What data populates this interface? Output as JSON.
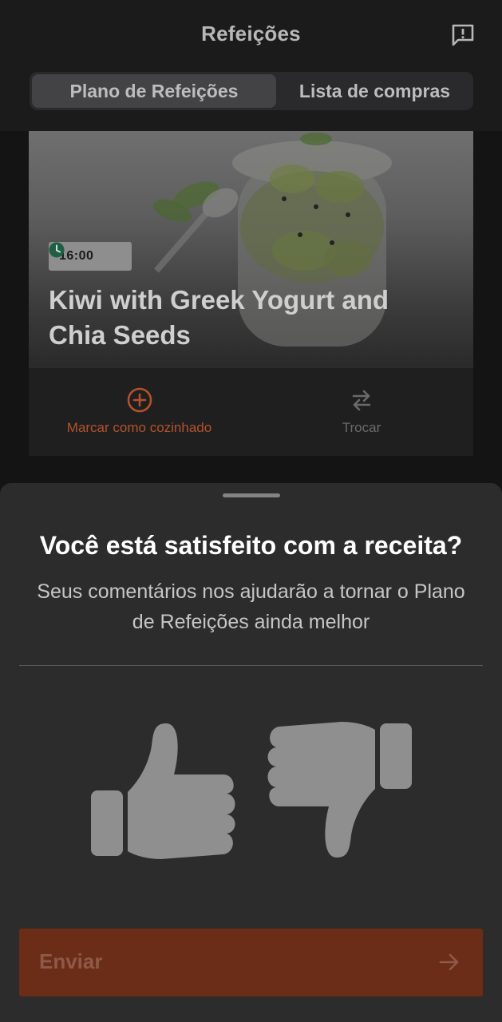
{
  "header": {
    "title": "Refeições",
    "tabs": [
      {
        "label": "Plano de Refeições",
        "active": true
      },
      {
        "label": "Lista de compras",
        "active": false
      }
    ],
    "feedback_icon": "feedback-flag-icon"
  },
  "recipe_card": {
    "time": "16:00",
    "title": "Kiwi with Greek Yogurt and Chia Seeds",
    "actions": {
      "cook": {
        "label": "Marcar como cozinhado",
        "icon": "plus-circle-icon",
        "color": "#b4512b"
      },
      "swap": {
        "label": "Trocar",
        "icon": "swap-arrows-icon"
      }
    }
  },
  "feedback_sheet": {
    "title": "Você está satisfeito com a receita?",
    "subtitle": "Seus comentários nos ajudarão a tornar o Plano de Refeições ainda melhor",
    "options": [
      "thumbs-up-icon",
      "thumbs-down-icon"
    ],
    "submit_label": "Enviar",
    "submit_color": "#6c2d18"
  }
}
